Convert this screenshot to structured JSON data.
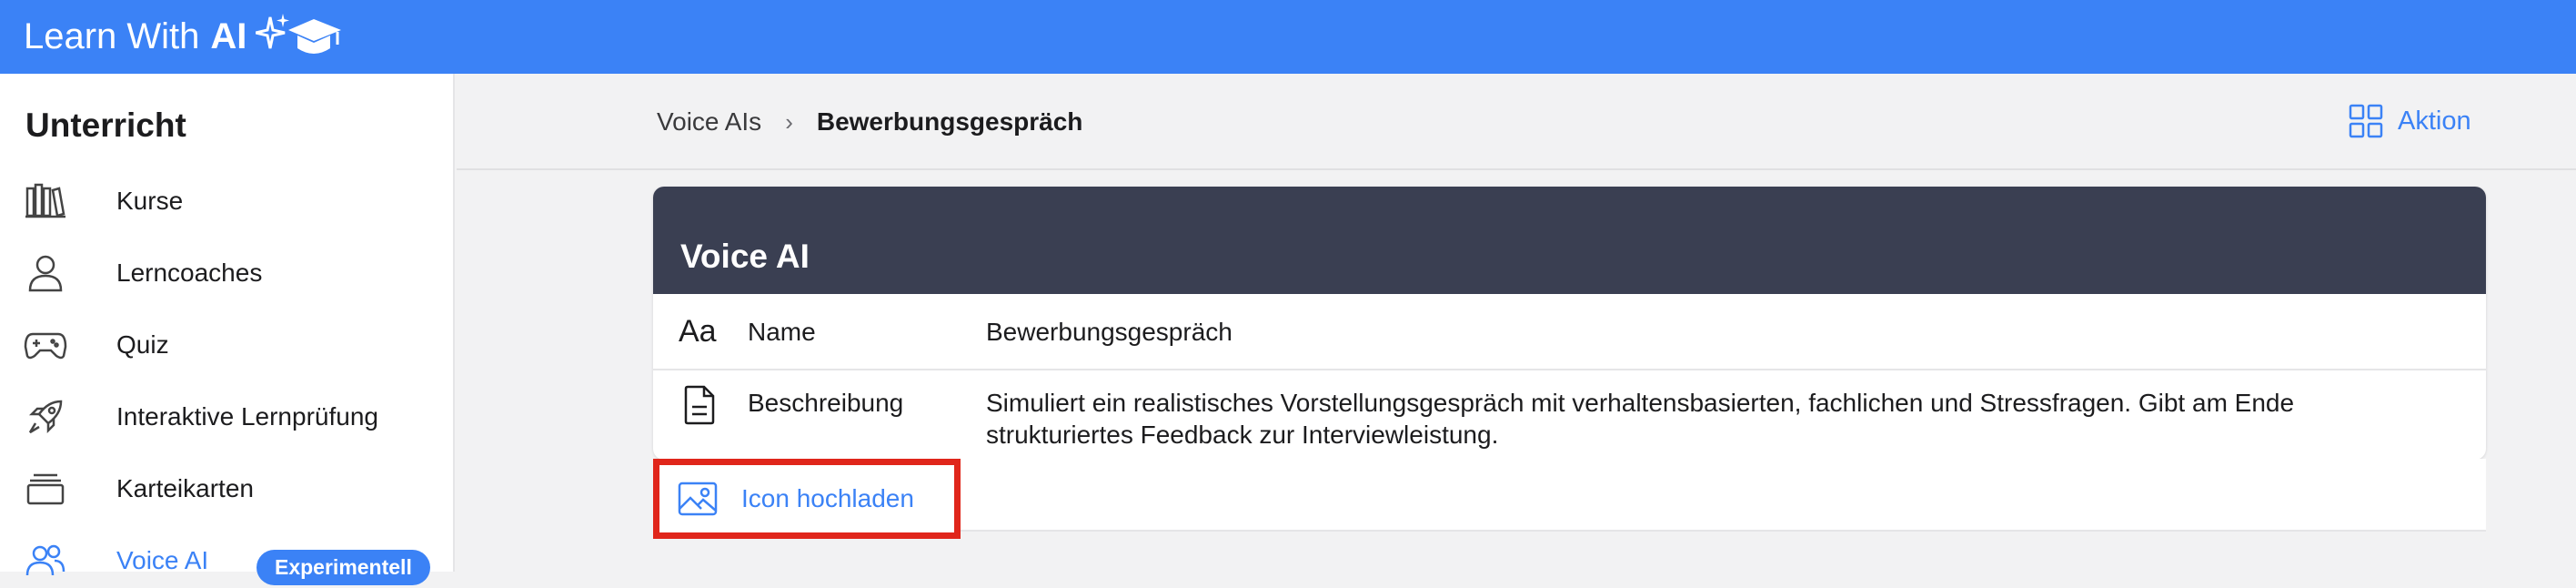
{
  "app": {
    "title_prefix": "Learn With",
    "title_ai": "AI"
  },
  "sidebar": {
    "heading": "Unterricht",
    "items": [
      {
        "label": "Kurse",
        "icon": "books-icon"
      },
      {
        "label": "Lerncoaches",
        "icon": "person-icon"
      },
      {
        "label": "Quiz",
        "icon": "gamepad-icon"
      },
      {
        "label": "Interaktive Lernprüfung",
        "icon": "rocket-icon"
      },
      {
        "label": "Karteikarten",
        "icon": "card-stack-icon"
      },
      {
        "label": "Voice AI",
        "icon": "users-icon",
        "badge": "Experimentell",
        "active": true
      }
    ]
  },
  "header": {
    "breadcrumb": {
      "parent": "Voice AIs",
      "current": "Bewerbungsgespräch"
    },
    "action_label": "Aktion"
  },
  "card": {
    "title": "Voice AI",
    "name_label": "Name",
    "name_value": "Bewerbungsgespräch",
    "desc_label": "Beschreibung",
    "desc_value": "Simuliert ein realistisches Vorstellungsgespräch mit verhaltensbasierten, fachlichen und Stressfragen. Gibt am Ende strukturiertes Feedback zur Interviewleistung."
  },
  "upload": {
    "label": "Icon hochladen"
  },
  "colors": {
    "accent": "#3b82f6",
    "header_dark": "#3a3f52",
    "highlight": "#e0261b"
  }
}
